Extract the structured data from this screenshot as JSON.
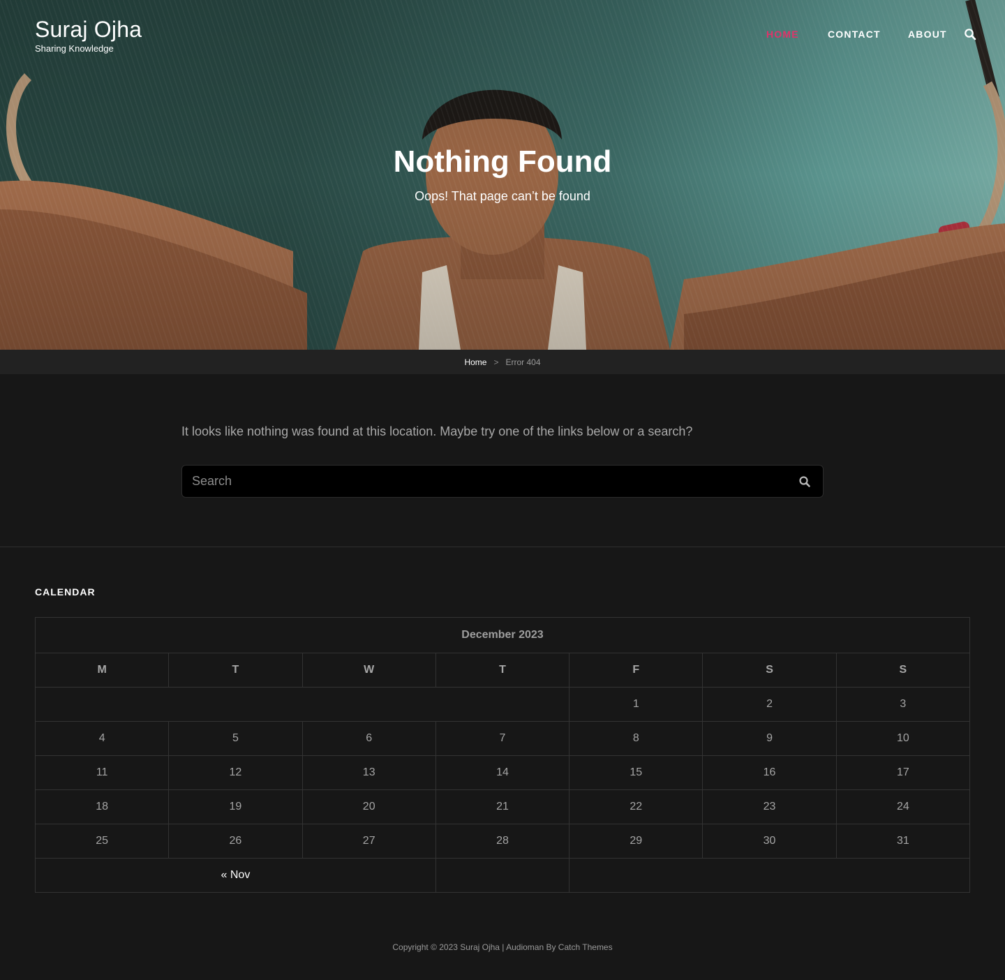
{
  "header": {
    "site_title": "Suraj Ojha",
    "tagline": "Sharing Knowledge",
    "nav": [
      {
        "label": "HOME",
        "active": true
      },
      {
        "label": "CONTACT",
        "active": false
      },
      {
        "label": "ABOUT",
        "active": false
      }
    ],
    "search_icon": "search-icon",
    "accent_color": "#e0336a"
  },
  "hero": {
    "title": "Nothing Found",
    "subtitle": "Oops! That page can’t be found"
  },
  "breadcrumb": {
    "home": "Home",
    "separator": ">",
    "current": "Error 404"
  },
  "main": {
    "notice": "It looks like nothing was found at this location. Maybe try one of the links below or a search?",
    "search": {
      "placeholder": "Search",
      "value": "",
      "icon": "search-icon"
    }
  },
  "calendar": {
    "heading": "CALENDAR",
    "caption": "December 2023",
    "weekdays": [
      "M",
      "T",
      "W",
      "T",
      "F",
      "S",
      "S"
    ],
    "weeks": [
      [
        "",
        "",
        "",
        "",
        "1",
        "2",
        "3"
      ],
      [
        "4",
        "5",
        "6",
        "7",
        "8",
        "9",
        "10"
      ],
      [
        "11",
        "12",
        "13",
        "14",
        "15",
        "16",
        "17"
      ],
      [
        "18",
        "19",
        "20",
        "21",
        "22",
        "23",
        "24"
      ],
      [
        "25",
        "26",
        "27",
        "28",
        "29",
        "30",
        "31"
      ]
    ],
    "prev_link": "« Nov"
  },
  "footer": {
    "text": "Copyright © 2023 Suraj Ojha | Audioman By Catch Themes"
  }
}
